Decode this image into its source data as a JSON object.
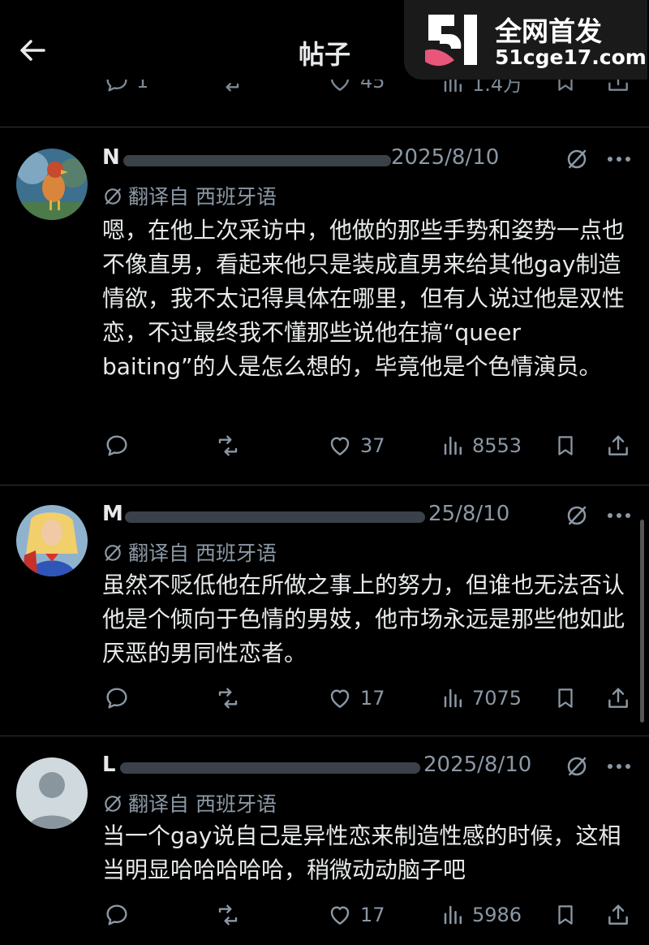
{
  "header": {
    "title": "帖子"
  },
  "watermark": {
    "line1": "全网首发",
    "line2": "51cge17.com"
  },
  "previous_post": {
    "replies": "1",
    "likes": "45",
    "views": "1.4万"
  },
  "translated_label": "翻译自 西班牙语",
  "posts": [
    {
      "username": "N",
      "date": "2025/8/10",
      "text": "嗯，在他上次采访中，他做的那些手势和姿势一点也不像直男，看起来他只是装成直男来给其他gay制造情欲，我不太记得具体在哪里，但有人说过他是双性恋，不过最终我不懂那些说他在搞“queer baiting”的人是怎么想的，毕竟他是个色情演员。",
      "likes": "37",
      "views": "8553"
    },
    {
      "username": "M",
      "date": "25/8/10",
      "text": "虽然不贬低他在所做之事上的努力，但谁也无法否认他是个倾向于色情的男妓，他市场永远是那些他如此厌恶的男同性恋者。",
      "likes": "17",
      "views": "7075"
    },
    {
      "username": "L",
      "date": "2025/8/10",
      "text": "当一个gay说自己是异性恋来制造性感的时候，这相当明显哈哈哈哈哈，稍微动动脑子吧",
      "likes": "17",
      "views": "5986"
    }
  ],
  "colors": {
    "background": "#000000",
    "text": "#e7e9ea",
    "muted": "#8b98a5",
    "divider": "#2f3336",
    "watermark_pink": "#e8567a"
  },
  "icons": [
    "back-arrow-icon",
    "reply-icon",
    "retweet-icon",
    "like-icon",
    "views-icon",
    "bookmark-icon",
    "share-icon",
    "grok-icon",
    "more-icon",
    "translate-icon"
  ]
}
